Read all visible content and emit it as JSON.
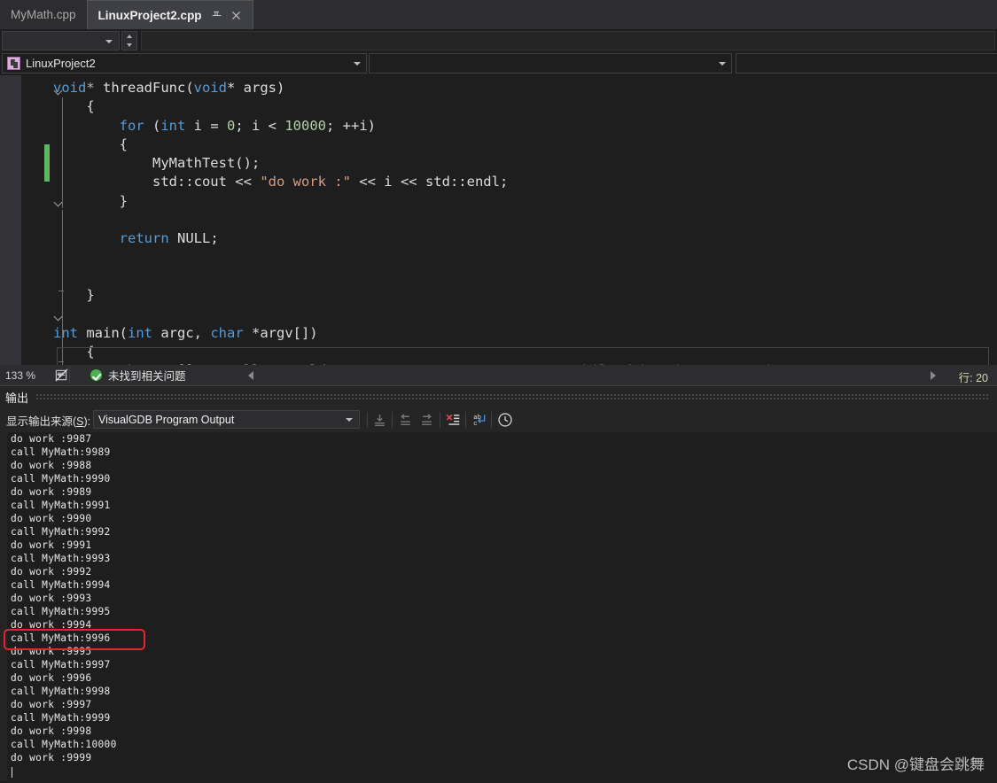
{
  "window": {
    "theme_bg": "#1e1e1e",
    "accent": "#007acc"
  },
  "tabs": [
    {
      "label": "MyMath.cpp",
      "active": false
    },
    {
      "label": "LinuxProject2.cpp",
      "active": true
    }
  ],
  "tab_icons": {
    "pin": "pin-icon",
    "close": "close-icon"
  },
  "navbar": {
    "project_label": "LinuxProject2",
    "member_label": "",
    "detail_label": "",
    "blank_combo_value": ""
  },
  "editor": {
    "code_lines": [
      {
        "indent": 0,
        "tokens": [
          {
            "t": "void",
            "c": "kw"
          },
          {
            "t": "* ",
            "c": "op"
          },
          {
            "t": "threadFunc",
            "c": "plain"
          },
          {
            "t": "(",
            "c": "punct"
          },
          {
            "t": "void",
            "c": "kw"
          },
          {
            "t": "* args)",
            "c": "plain"
          }
        ]
      },
      {
        "indent": 1,
        "tokens": [
          {
            "t": "{",
            "c": "punct"
          }
        ]
      },
      {
        "indent": 2,
        "tokens": [
          {
            "t": "for",
            "c": "kw"
          },
          {
            "t": " (",
            "c": "punct"
          },
          {
            "t": "int",
            "c": "kw"
          },
          {
            "t": " i = ",
            "c": "plain"
          },
          {
            "t": "0",
            "c": "num"
          },
          {
            "t": "; i < ",
            "c": "plain"
          },
          {
            "t": "10000",
            "c": "num"
          },
          {
            "t": "; ++i)",
            "c": "plain"
          }
        ]
      },
      {
        "indent": 2,
        "tokens": [
          {
            "t": "{",
            "c": "punct"
          }
        ]
      },
      {
        "indent": 3,
        "tokens": [
          {
            "t": "MyMathTest();",
            "c": "plain"
          }
        ]
      },
      {
        "indent": 3,
        "tokens": [
          {
            "t": "std::cout << ",
            "c": "plain"
          },
          {
            "t": "\"do work :\"",
            "c": "str"
          },
          {
            "t": " << i << std::endl;",
            "c": "plain"
          }
        ]
      },
      {
        "indent": 2,
        "tokens": [
          {
            "t": "}",
            "c": "punct"
          }
        ]
      },
      {
        "indent": 0,
        "tokens": []
      },
      {
        "indent": 2,
        "tokens": [
          {
            "t": "return",
            "c": "kw"
          },
          {
            "t": " NULL;",
            "c": "plain"
          }
        ]
      },
      {
        "indent": 0,
        "tokens": []
      },
      {
        "indent": 0,
        "tokens": []
      },
      {
        "indent": 1,
        "tokens": [
          {
            "t": "}",
            "c": "punct"
          }
        ]
      },
      {
        "indent": 0,
        "tokens": []
      },
      {
        "indent": 0,
        "tokens": [
          {
            "t": "int",
            "c": "kw"
          },
          {
            "t": " main(",
            "c": "plain"
          },
          {
            "t": "int",
            "c": "kw"
          },
          {
            "t": " argc, ",
            "c": "plain"
          },
          {
            "t": "char",
            "c": "kw"
          },
          {
            "t": " *argv[])",
            "c": "plain"
          }
        ]
      },
      {
        "indent": 1,
        "tokens": [
          {
            "t": "{",
            "c": "punct"
          }
        ]
      },
      {
        "indent": 2,
        "tokens": [
          {
            "t": "char",
            "c": "kw"
          },
          {
            "t": " sz[] = ",
            "c": "plain"
          },
          {
            "t": "\"Hello, World!\"",
            "c": "str"
          },
          {
            "t": ";   ",
            "c": "plain"
          },
          {
            "t": "//Hover mouse over \"sz\" while debugging to see its contents",
            "c": "cmt"
          }
        ]
      }
    ]
  },
  "editor_status": {
    "zoom": "133 %",
    "issues_text": "未找到相关问题",
    "line_label": "行: 20"
  },
  "output_pane": {
    "title": "输出",
    "source_label_pre": "显示输出来源(",
    "source_label_key": "S",
    "source_label_post": "):",
    "source_value": "VisualGDB Program Output",
    "toolbar_icons": [
      "navigate-to-source-icon",
      "go-to-previous-icon",
      "go-to-next-icon",
      "clear-all-icon",
      "toggle-word-wrap-icon",
      "show-output-history-icon"
    ],
    "lines": [
      "do work :9987",
      "call MyMath:9989",
      "do work :9988",
      "call MyMath:9990",
      "do work :9989",
      "call MyMath:9991",
      "do work :9990",
      "call MyMath:9992",
      "do work :9991",
      "call MyMath:9993",
      "do work :9992",
      "call MyMath:9994",
      "do work :9993",
      "call MyMath:9995",
      "do work :9994",
      "call MyMath:9996",
      "do work :9995",
      "call MyMath:9997",
      "do work :9996",
      "call MyMath:9998",
      "do work :9997",
      "call MyMath:9999",
      "do work :9998",
      "call MyMath:10000",
      "do work :9999"
    ],
    "highlighted_line_index": 15,
    "highlight_color": "#e8242a"
  },
  "watermark": "CSDN @键盘会跳舞"
}
